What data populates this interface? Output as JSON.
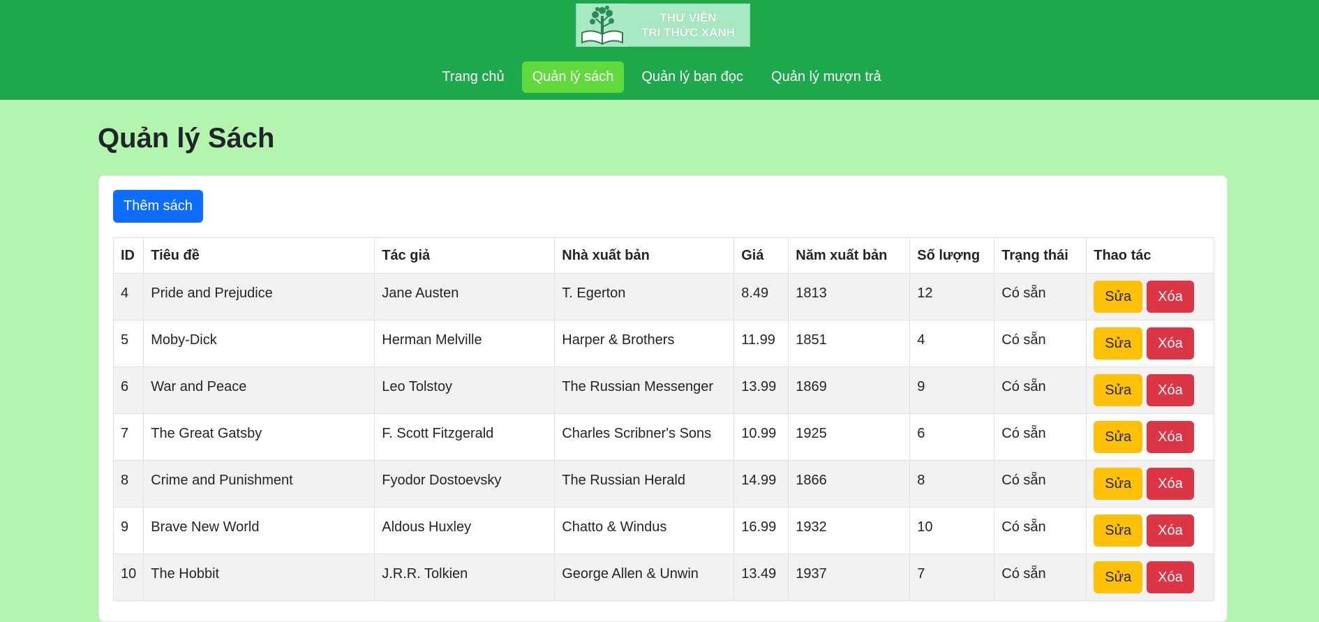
{
  "brand": {
    "line1": "THƯ VIỆN",
    "line2": "TRI THỨC XANH",
    "icon": "tree-book-icon"
  },
  "nav": {
    "items": [
      {
        "label": "Trang chủ",
        "active": false
      },
      {
        "label": "Quản lý sách",
        "active": true
      },
      {
        "label": "Quản lý bạn đọc",
        "active": false
      },
      {
        "label": "Quản lý mượn trả",
        "active": false
      }
    ]
  },
  "page": {
    "title": "Quản lý Sách",
    "add_button": "Thêm sách"
  },
  "table": {
    "headers": [
      "ID",
      "Tiêu đề",
      "Tác giả",
      "Nhà xuất bản",
      "Giá",
      "Năm xuất bản",
      "Số lượng",
      "Trạng thái",
      "Thao tác"
    ],
    "edit_label": "Sửa",
    "delete_label": "Xóa",
    "rows": [
      {
        "id": "4",
        "title": "Pride and Prejudice",
        "author": "Jane Austen",
        "publisher": "T. Egerton",
        "price": "8.49",
        "year": "1813",
        "qty": "12",
        "status": "Có sẵn"
      },
      {
        "id": "5",
        "title": "Moby-Dick",
        "author": "Herman Melville",
        "publisher": "Harper & Brothers",
        "price": "11.99",
        "year": "1851",
        "qty": "4",
        "status": "Có sẵn"
      },
      {
        "id": "6",
        "title": "War and Peace",
        "author": "Leo Tolstoy",
        "publisher": "The Russian Messenger",
        "price": "13.99",
        "year": "1869",
        "qty": "9",
        "status": "Có sẵn"
      },
      {
        "id": "7",
        "title": "The Great Gatsby",
        "author": "F. Scott Fitzgerald",
        "publisher": "Charles Scribner's Sons",
        "price": "10.99",
        "year": "1925",
        "qty": "6",
        "status": "Có sẵn"
      },
      {
        "id": "8",
        "title": "Crime and Punishment",
        "author": "Fyodor Dostoevsky",
        "publisher": "The Russian Herald",
        "price": "14.99",
        "year": "1866",
        "qty": "8",
        "status": "Có sẵn"
      },
      {
        "id": "9",
        "title": "Brave New World",
        "author": "Aldous Huxley",
        "publisher": "Chatto & Windus",
        "price": "16.99",
        "year": "1932",
        "qty": "10",
        "status": "Có sẵn"
      },
      {
        "id": "10",
        "title": "The Hobbit",
        "author": "J.R.R. Tolkien",
        "publisher": "George Allen & Unwin",
        "price": "13.49",
        "year": "1937",
        "qty": "7",
        "status": "Có sẵn"
      }
    ]
  },
  "colors": {
    "header_bg": "#1ea84c",
    "page_bg": "#b3f5ae",
    "nav_active": "#5fd93b",
    "primary": "#0d6efd",
    "warning": "#ffc107",
    "danger": "#dc3545"
  }
}
